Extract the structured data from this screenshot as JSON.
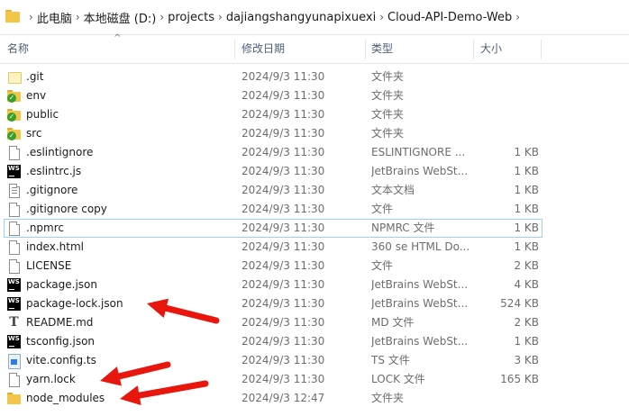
{
  "breadcrumb": {
    "items": [
      "此电脑",
      "本地磁盘 (D:)",
      "projects",
      "dajiangshangyunapixuexi",
      "Cloud-API-Demo-Web"
    ],
    "separator": "›"
  },
  "columns": {
    "name": "名称",
    "date": "修改日期",
    "type": "类型",
    "size": "大小"
  },
  "files": [
    {
      "name": ".git",
      "date": "2024/9/3 11:30",
      "type": "文件夹",
      "size": "",
      "icon": "folder-plain-icon"
    },
    {
      "name": "env",
      "date": "2024/9/3 11:30",
      "type": "文件夹",
      "size": "",
      "icon": "folder-synced-icon"
    },
    {
      "name": "public",
      "date": "2024/9/3 11:30",
      "type": "文件夹",
      "size": "",
      "icon": "folder-synced-icon"
    },
    {
      "name": "src",
      "date": "2024/9/3 11:30",
      "type": "文件夹",
      "size": "",
      "icon": "folder-synced-icon"
    },
    {
      "name": ".eslintignore",
      "date": "2024/9/3 11:30",
      "type": "ESLINTIGNORE ...",
      "size": "1 KB",
      "icon": "file-icon"
    },
    {
      "name": ".eslintrc.js",
      "date": "2024/9/3 11:30",
      "type": "JetBrains WebSt...",
      "size": "1 KB",
      "icon": "webstorm-icon"
    },
    {
      "name": ".gitignore",
      "date": "2024/9/3 11:30",
      "type": "文本文档",
      "size": "1 KB",
      "icon": "text-file-icon"
    },
    {
      "name": ".gitignore copy",
      "date": "2024/9/3 11:30",
      "type": "文件",
      "size": "1 KB",
      "icon": "file-icon"
    },
    {
      "name": ".npmrc",
      "date": "2024/9/3 11:30",
      "type": "NPMRC 文件",
      "size": "1 KB",
      "icon": "file-icon",
      "selected": true
    },
    {
      "name": "index.html",
      "date": "2024/9/3 11:30",
      "type": "360 se HTML Do...",
      "size": "1 KB",
      "icon": "file-icon"
    },
    {
      "name": "LICENSE",
      "date": "2024/9/3 11:30",
      "type": "文件",
      "size": "2 KB",
      "icon": "file-icon"
    },
    {
      "name": "package.json",
      "date": "2024/9/3 11:30",
      "type": "JetBrains WebSt...",
      "size": "4 KB",
      "icon": "webstorm-icon"
    },
    {
      "name": "package-lock.json",
      "date": "2024/9/3 11:30",
      "type": "JetBrains WebSt...",
      "size": "524 KB",
      "icon": "webstorm-icon"
    },
    {
      "name": "README.md",
      "date": "2024/9/3 11:30",
      "type": "MD 文件",
      "size": "2 KB",
      "icon": "markdown-icon"
    },
    {
      "name": "tsconfig.json",
      "date": "2024/9/3 11:30",
      "type": "JetBrains WebSt...",
      "size": "1 KB",
      "icon": "webstorm-icon"
    },
    {
      "name": "vite.config.ts",
      "date": "2024/9/3 11:30",
      "type": "TS 文件",
      "size": "3 KB",
      "icon": "typescript-file-icon"
    },
    {
      "name": "yarn.lock",
      "date": "2024/9/3 11:30",
      "type": "LOCK 文件",
      "size": "165 KB",
      "icon": "file-icon"
    },
    {
      "name": "node_modules",
      "date": "2024/9/3 12:47",
      "type": "文件夹",
      "size": "",
      "icon": "folder-icon"
    }
  ],
  "annotation_color": "#e8160c"
}
